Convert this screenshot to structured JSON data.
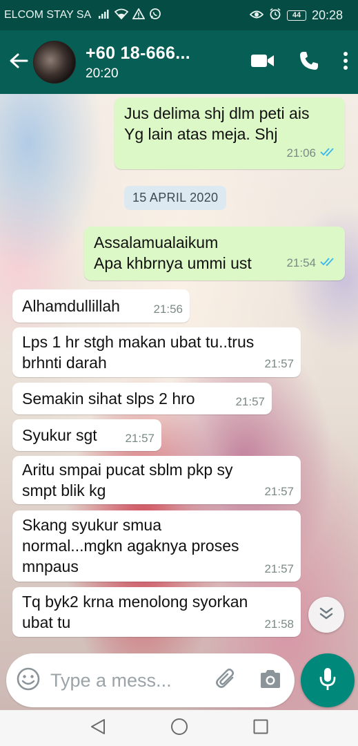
{
  "status_bar": {
    "carrier": "ELCOM STAY SA",
    "battery": "44",
    "time": "20:28"
  },
  "header": {
    "contact_name": "+60 18-666...",
    "contact_status": "20:20"
  },
  "chat": {
    "messages": [
      {
        "direction": "out",
        "lines": [
          "Jus delima shj dlm peti ais",
          "Yg lain atas meja. Shj"
        ],
        "time": "21:06",
        "read": true
      },
      {
        "direction": "date",
        "text": "15 APRIL 2020"
      },
      {
        "direction": "out",
        "lines": [
          "Assalamualaikum",
          "Apa khbrnya ummi ust"
        ],
        "time": "21:54",
        "read": true
      },
      {
        "direction": "in",
        "lines": [
          "Alhamdullillah"
        ],
        "time": "21:56"
      },
      {
        "direction": "in",
        "lines": [
          "Lps 1 hr stgh makan ubat tu..trus",
          "brhnti darah"
        ],
        "time": "21:57"
      },
      {
        "direction": "in",
        "lines": [
          "Semakin sihat slps 2 hro"
        ],
        "time": "21:57"
      },
      {
        "direction": "in",
        "lines": [
          "Syukur sgt"
        ],
        "time": "21:57"
      },
      {
        "direction": "in",
        "lines": [
          "Aritu smpai pucat  sblm pkp sy",
          "smpt blik kg"
        ],
        "time": "21:57"
      },
      {
        "direction": "in",
        "lines": [
          "Skang syukur smua",
          "normal...mgkn agaknya proses",
          "mnpaus"
        ],
        "time": "21:57"
      },
      {
        "direction": "in",
        "lines": [
          "Tq byk2 krna menolong syorkan",
          "ubat tu"
        ],
        "time": "21:58"
      }
    ]
  },
  "composer": {
    "placeholder": "Type a mess..."
  },
  "icons": {
    "back": "arrow-left-icon",
    "video_call": "video-camera-icon",
    "voice_call": "phone-icon",
    "menu": "more-vertical-icon",
    "emoji": "emoji-icon",
    "attach": "paperclip-icon",
    "camera": "camera-icon",
    "mic": "mic-icon",
    "scroll_down": "double-chevron-down-icon",
    "read_receipt": "double-check-icon"
  },
  "colors": {
    "header": "#075e54",
    "status_bar": "#054d44",
    "outgoing_bubble": "#dcf8c6",
    "incoming_bubble": "#ffffff",
    "read_tick": "#34b7f1",
    "mic_button": "#00897b"
  }
}
